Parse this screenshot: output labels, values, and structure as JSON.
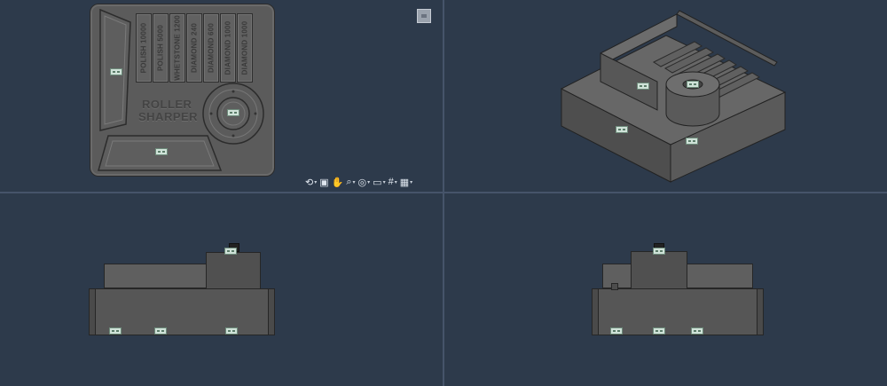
{
  "app": {
    "viewports": [
      "top-view",
      "isometric-view",
      "front-view",
      "right-view"
    ],
    "background_color": "#2d3a4b",
    "model_color": "#5b5b5b"
  },
  "model": {
    "slots": [
      "POLISH 10000",
      "POLISH 5000",
      "WHETSTONE 1200",
      "DIAMOND 240",
      "DIAMOND 600",
      "DIAMOND 1000",
      "DIAMOND 1000"
    ],
    "logo_line1": "ROLLER",
    "logo_line2": "SHARPER"
  },
  "toolbar": {
    "items": [
      {
        "name": "orbit-icon",
        "glyph": "⟲"
      },
      {
        "name": "view-cube-icon",
        "glyph": "▣"
      },
      {
        "name": "pan-hand-icon",
        "glyph": "✋"
      },
      {
        "name": "zoom-icon",
        "glyph": "⌕"
      },
      {
        "name": "fit-view-icon",
        "glyph": "◎"
      },
      {
        "name": "display-mode-icon",
        "glyph": "▭"
      },
      {
        "name": "grid-icon",
        "glyph": "#"
      },
      {
        "name": "viewports-layout-icon",
        "glyph": "▦"
      }
    ]
  }
}
